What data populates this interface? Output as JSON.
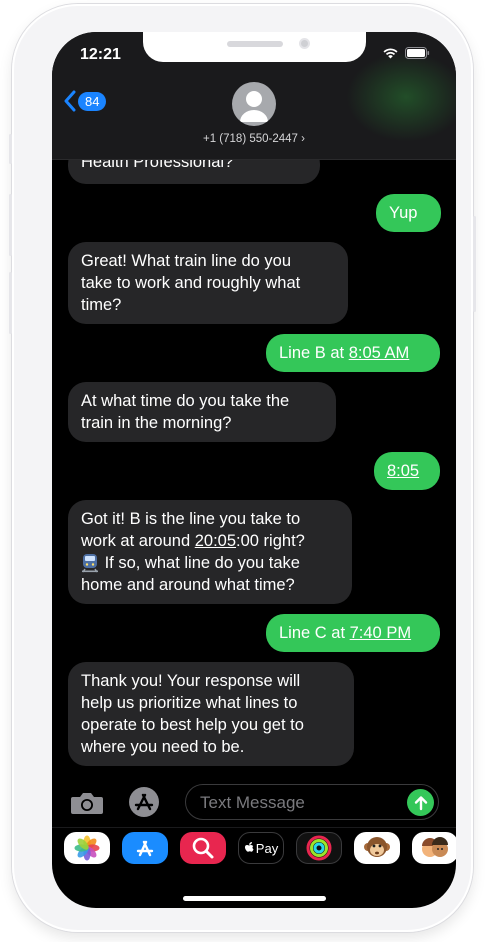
{
  "status": {
    "time": "12:21"
  },
  "nav": {
    "back_count": "84",
    "contact": "+1 (718) 550-2447 ›"
  },
  "messages": {
    "m0": "Health Professional?",
    "m1": "Yup",
    "m2": {
      "line1": "Great! What train line do you",
      "line2": "take to work and roughly what",
      "line3": "time?"
    },
    "m3": {
      "text": "Line B at ",
      "time": "8:05 AM"
    },
    "m4": {
      "line1": "At what time do you take the",
      "line2": "train in the morning?"
    },
    "m5": "8:05",
    "m6": {
      "line1": "Got it! B is the line you take to",
      "line2a": "work at around ",
      "line2b": "20:05",
      "line2c": ":00 right?",
      "line3": " If so, what line do you take",
      "line4": "home and around what time?"
    },
    "m7": {
      "text": "Line C at ",
      "time": "7:40 PM"
    },
    "m8": {
      "line1": "Thank you! Your response will",
      "line2": "help us prioritize what lines to",
      "line3": "operate to best help you get to",
      "line4": "where you need to be."
    }
  },
  "composer": {
    "placeholder": "Text Message"
  },
  "tray": {
    "apps": [
      "photos-icon",
      "app-store-icon",
      "search-images-icon",
      "apple-pay-icon",
      "activity-icon",
      "monkey-memoji-icon",
      "memoji-icon"
    ],
    "pay_label": "Pay"
  }
}
